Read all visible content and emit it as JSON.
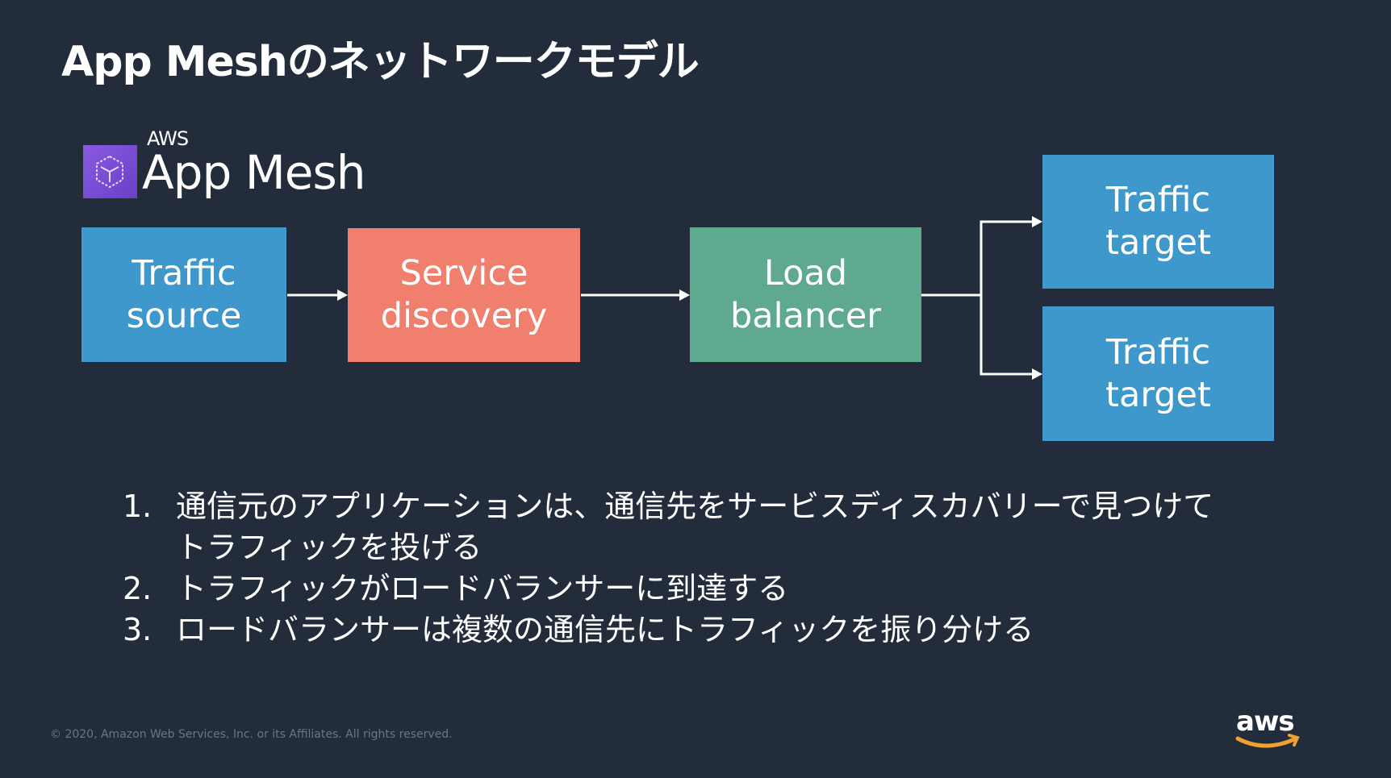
{
  "title": "App Meshのネットワークモデル",
  "colors": {
    "background": "#232c3b",
    "blue": "#3f98cb",
    "salmon": "#f07f6e",
    "green": "#5fa98e",
    "purple": "#7b4dd6",
    "aws_orange": "#f0a030"
  },
  "product": {
    "vendor": "AWS",
    "name": "App Mesh",
    "icon": "app-mesh-cube-icon"
  },
  "diagram": {
    "source": {
      "line1": "Traffic",
      "line2": "source"
    },
    "discovery": {
      "line1": "Service",
      "line2": "discovery"
    },
    "balancer": {
      "line1": "Load",
      "line2": "balancer"
    },
    "targets": [
      {
        "line1": "Traffic",
        "line2": "target"
      },
      {
        "line1": "Traffic",
        "line2": "target"
      }
    ]
  },
  "steps": [
    {
      "num": "1.",
      "text": "通信元のアプリケーションは、通信先をサービスディスカバリーで見つけてトラフィックを投げる"
    },
    {
      "num": "2.",
      "text": "トラフィックがロードバランサーに到達する"
    },
    {
      "num": "3.",
      "text": "ロードバランサーは複数の通信先にトラフィックを振り分ける"
    }
  ],
  "footer": {
    "copyright": "© 2020, Amazon Web Services, Inc. or its Affiliates. All rights reserved.",
    "logo": "aws"
  }
}
